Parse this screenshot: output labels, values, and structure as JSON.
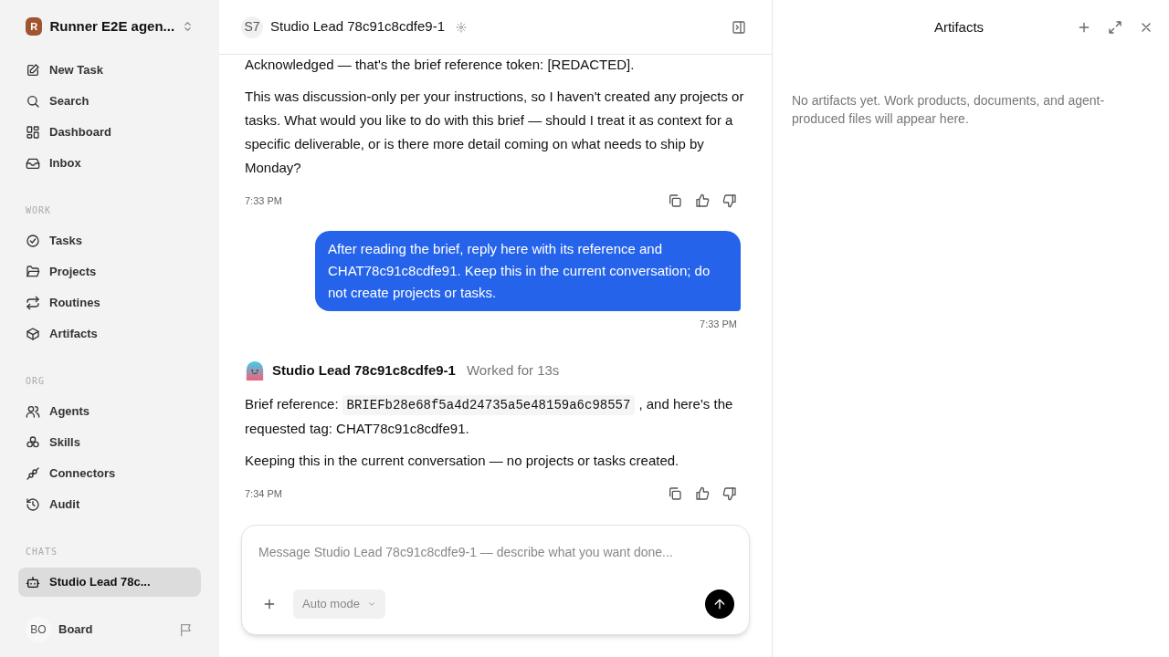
{
  "workspace": {
    "avatar": "R",
    "name": "Runner E2E agen..."
  },
  "nav": [
    {
      "label": "New Task",
      "selected": false
    },
    {
      "label": "Search",
      "selected": false
    },
    {
      "label": "Dashboard",
      "selected": false
    },
    {
      "label": "Inbox",
      "selected": false
    }
  ],
  "sections": [
    {
      "title": "WORK",
      "items": [
        {
          "label": "Tasks",
          "selected": false
        },
        {
          "label": "Projects",
          "selected": false
        },
        {
          "label": "Routines",
          "selected": false
        },
        {
          "label": "Artifacts",
          "selected": false
        }
      ]
    },
    {
      "title": "ORG",
      "items": [
        {
          "label": "Agents",
          "selected": false
        },
        {
          "label": "Skills",
          "selected": false
        },
        {
          "label": "Connectors",
          "selected": false
        },
        {
          "label": "Audit",
          "selected": false
        }
      ]
    },
    {
      "title": "CHATS",
      "items": [
        {
          "label": "Studio Lead 78c...",
          "selected": true
        }
      ]
    }
  ],
  "user": {
    "initials": "BO",
    "name": "Board"
  },
  "chat": {
    "avatar": "S7",
    "title": "Studio Lead 78c91c8cdfe9-1",
    "messages": [
      {
        "kind": "agent",
        "paragraphs": [
          [
            {
              "text": "Acknowledged — that's the brief reference token: [REDACTED]."
            }
          ],
          [
            {
              "text": "This was discussion-only per your instructions, so I haven't created any projects or tasks. What would you like to do with this brief — should I treat it as context for a specific deliverable, or is there more detail coming on what needs to ship by Monday?"
            }
          ]
        ],
        "time": "7:33 PM"
      },
      {
        "kind": "user",
        "text": "After reading the brief, reply here with its reference and CHAT78c91c8cdfe91. Keep this in the current conversation; do not create projects or tasks.",
        "time": "7:33 PM"
      },
      {
        "kind": "agent",
        "sender": "Studio Lead 78c91c8cdfe9-1",
        "note": "Worked for 13s",
        "paragraphs": [
          [
            {
              "text": "Brief reference:"
            },
            {
              "code": "BRIEFb28e68f5a4d24735a5e48159a6c98557"
            },
            {
              "text": ", and here's the requested tag: CHAT78c91c8cdfe91."
            }
          ],
          [
            {
              "text": "Keeping this in the current conversation — no projects or tasks created."
            }
          ]
        ],
        "time": "7:34 PM"
      }
    ],
    "composer": {
      "placeholder": "Message Studio Lead 78c91c8cdfe9-1 — describe what you want done...",
      "mode": "Auto mode"
    }
  },
  "artifacts": {
    "title": "Artifacts",
    "empty": "No artifacts yet. Work products, documents, and agent-produced files will appear here."
  }
}
